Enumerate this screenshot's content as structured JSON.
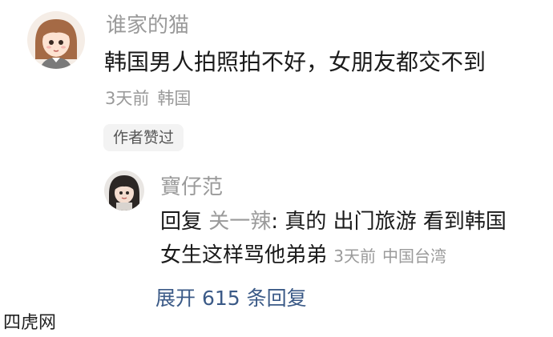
{
  "comment": {
    "username": "谁家的猫",
    "text": "韩国男人拍照拍不好，女朋友都交不到",
    "time": "3天前",
    "location": "韩国",
    "author_liked": "作者赞过"
  },
  "reply": {
    "username": "寶仔范",
    "prefix": "回复",
    "reply_to": "关一辣",
    "text_line1": ": 真的 出门旅游 看到韩国",
    "text_line2": "女生这样骂他弟弟",
    "time": "3天前",
    "location": "中国台湾"
  },
  "expand_label": "展开 615 条回复",
  "watermark": "四虎网",
  "colors": {
    "text": "#1a1a1a",
    "secondary": "#9a9a9a",
    "link": "#3b5a87",
    "badge_bg": "#f3f3f3"
  }
}
